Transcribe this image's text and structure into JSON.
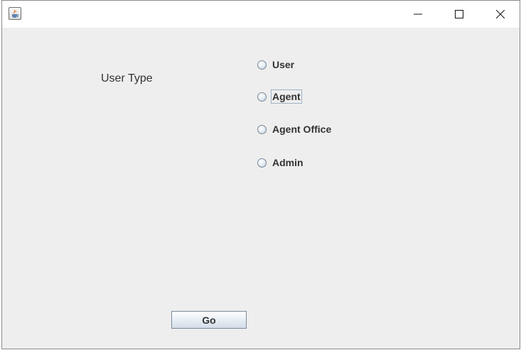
{
  "window": {
    "icon": "java-cup-icon",
    "controls": {
      "minimize": "minimize-icon",
      "maximize": "maximize-icon",
      "close": "close-icon"
    }
  },
  "form": {
    "user_type_label": "User Type",
    "options": [
      {
        "label": "User",
        "selected": false
      },
      {
        "label": "Agent",
        "selected": false,
        "focused": true
      },
      {
        "label": "Agent Office",
        "selected": false
      },
      {
        "label": "Admin",
        "selected": false
      }
    ],
    "go_label": "Go"
  },
  "colors": {
    "content_background": "#eeeeee",
    "titlebar_background": "#ffffff",
    "text": "#333333",
    "control_border": "#7a8a99"
  }
}
